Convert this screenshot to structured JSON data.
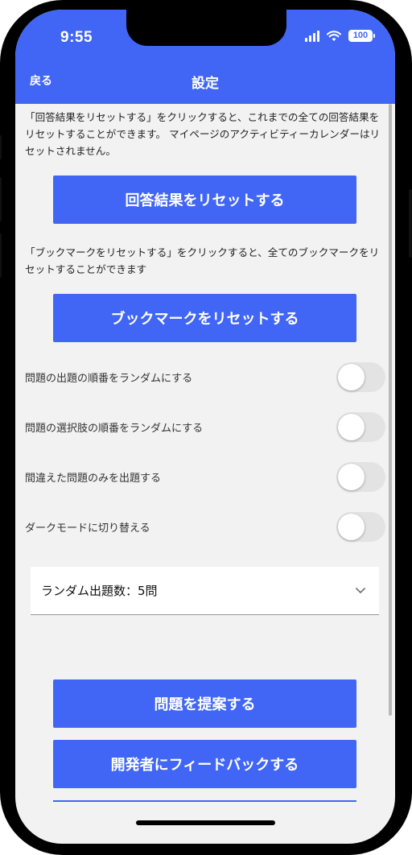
{
  "status_bar": {
    "time": "9:55",
    "battery": "100"
  },
  "header": {
    "back_label": "戻る",
    "title": "設定"
  },
  "reset_results": {
    "description": "「回答結果をリセットする」をクリックすると、これまでの全ての回答結果をリセットすることができます。 マイページのアクティビティーカレンダーはリセットされません。",
    "button_label": "回答結果をリセットする"
  },
  "reset_bookmarks": {
    "description": "「ブックマークをリセットする」をクリックすると、全てのブックマークをリセットすることができます",
    "button_label": "ブックマークをリセットする"
  },
  "toggles": [
    {
      "label": "問題の出題の順番をランダムにする",
      "on": false
    },
    {
      "label": "問題の選択肢の順番をランダムにする",
      "on": false
    },
    {
      "label": "間違えた問題のみを出題する",
      "on": false
    },
    {
      "label": "ダークモードに切り替える",
      "on": false
    }
  ],
  "random_count_select": {
    "value": "ランダム出題数：5問"
  },
  "suggest_button_label": "問題を提案する",
  "feedback_button_label": "開発者にフィードバックする",
  "colors": {
    "accent": "#4166f5",
    "background": "#f2f2f2"
  }
}
